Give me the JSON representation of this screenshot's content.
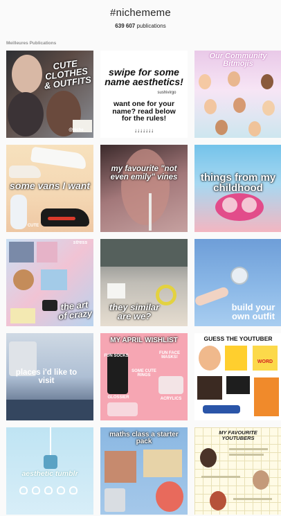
{
  "header": {
    "hashtag": "#nichememe",
    "post_count": "639 607",
    "post_count_suffix": " publications"
  },
  "section_label": "Meilleures Publications",
  "tiles": [
    {
      "caption": "CUTE CLOTHES & OUTFITS",
      "credit": "@niche"
    },
    {
      "title": "swipe for some name aesthetics!",
      "handle": "sushivirgo",
      "body": "want one for your name? read below for the rules!",
      "arrows": "↓↓↓↓↓↓↓"
    },
    {
      "title": "Our Community Bitmojis"
    },
    {
      "caption": "some vans I want",
      "sub": "CUTE"
    },
    {
      "caption": "my favourite \"not even emily\" vines"
    },
    {
      "caption": "things from my childhood"
    },
    {
      "caption": "the art of crazy",
      "sub": "stress"
    },
    {
      "caption": "they similar are we?"
    },
    {
      "caption": "build your own outfit"
    },
    {
      "caption": "places i'd like to visit"
    },
    {
      "title": "MY APRIL WISHLIST",
      "items": [
        "FUN SOCKS",
        "FUN FACE MASKS!",
        "SOME CUTE RINGS",
        "ACRYLICS",
        "GLOSSIER"
      ]
    },
    {
      "title": "GUESS THE YOUTUBER",
      "word": "WORD"
    },
    {
      "caption": "aesthetic tumblr"
    },
    {
      "title": "maths class a starter pack"
    },
    {
      "title": "MY FAVOURITE YOUTUBERS"
    }
  ],
  "colors": {
    "background": "#fafafa",
    "text": "#262626",
    "muted": "#8e8e8e"
  }
}
